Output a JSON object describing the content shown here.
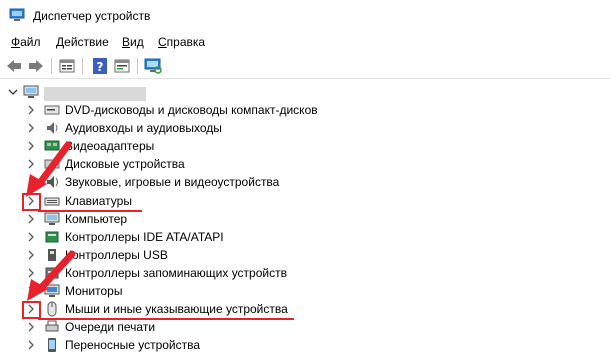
{
  "window": {
    "title": "Диспетчер устройств"
  },
  "menu": [
    {
      "acc": "Ф",
      "rest": "айл"
    },
    {
      "acc": "Д",
      "rest": "ействие"
    },
    {
      "acc": "В",
      "rest": "ид"
    },
    {
      "acc": "С",
      "rest": "правка"
    }
  ],
  "toolbar": {
    "buttons": [
      "back-icon",
      "forward-icon",
      "properties-icon",
      "help-icon",
      "update-driver-icon",
      "scan-hardware-icon"
    ]
  },
  "tree": {
    "root_label": "",
    "items": [
      {
        "label": "DVD-дисководы и дисководы компакт-дисков",
        "icon": "dvd-drive-icon"
      },
      {
        "label": "Аудиовходы и аудиовыходы",
        "icon": "audio-io-icon"
      },
      {
        "label": "Видеоадаптеры",
        "icon": "display-adapter-icon"
      },
      {
        "label": "Дисковые устройства",
        "icon": "disk-drive-icon"
      },
      {
        "label": "Звуковые, игровые и видеоустройства",
        "icon": "sound-device-icon"
      },
      {
        "label": "Клавиатуры",
        "icon": "keyboard-icon"
      },
      {
        "label": "Компьютер",
        "icon": "computer-icon"
      },
      {
        "label": "Контроллеры IDE ATA/ATAPI",
        "icon": "ide-controller-icon"
      },
      {
        "label": "Контроллеры USB",
        "icon": "usb-controller-icon"
      },
      {
        "label": "Контроллеры запоминающих устройств",
        "icon": "storage-controller-icon"
      },
      {
        "label": "Мониторы",
        "icon": "monitor-icon"
      },
      {
        "label": "Мыши и иные указывающие устройства",
        "icon": "mouse-icon"
      },
      {
        "label": "Очереди печати",
        "icon": "print-queue-icon"
      },
      {
        "label": "Переносные устройства",
        "icon": "portable-device-icon"
      }
    ]
  },
  "colors": {
    "annotation": "#e8222c",
    "chevron": "#5a5a5a"
  }
}
